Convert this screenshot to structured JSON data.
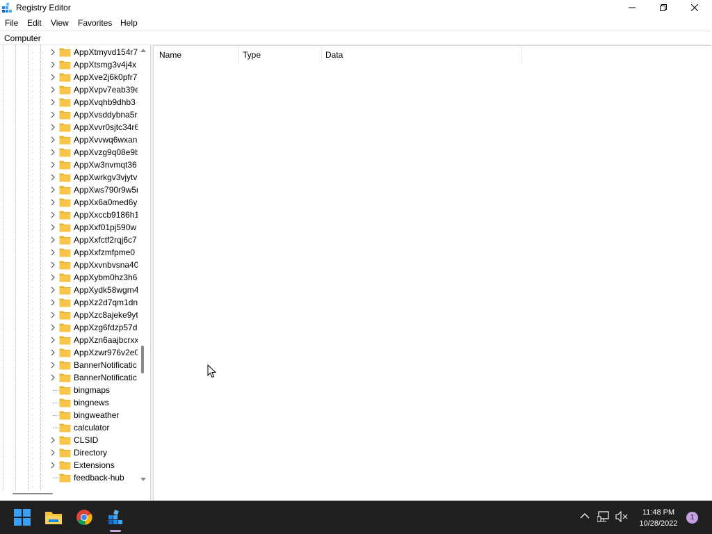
{
  "window": {
    "title": "Registry Editor"
  },
  "menu": [
    "File",
    "Edit",
    "View",
    "Favorites",
    "Help"
  ],
  "address": "Computer",
  "tree": [
    {
      "label": "AppXtmyvd154r7",
      "expandable": true
    },
    {
      "label": "AppXtsmg3v4j4x",
      "expandable": true
    },
    {
      "label": "AppXve2j6k0pfr7",
      "expandable": true
    },
    {
      "label": "AppXvpv7eab39e",
      "expandable": true
    },
    {
      "label": "AppXvqhb9dhb3",
      "expandable": true
    },
    {
      "label": "AppXvsddybna5r",
      "expandable": true
    },
    {
      "label": "AppXvvr0sjtc34r6",
      "expandable": true
    },
    {
      "label": "AppXvvwq6wxan",
      "expandable": true
    },
    {
      "label": "AppXvzg9q08e9b",
      "expandable": true
    },
    {
      "label": "AppXw3nvmqt36",
      "expandable": true
    },
    {
      "label": "AppXwrkgv3vjytv",
      "expandable": true
    },
    {
      "label": "AppXws790r9w5r",
      "expandable": true
    },
    {
      "label": "AppXx6a0med6y",
      "expandable": true
    },
    {
      "label": "AppXxccb9186h1",
      "expandable": true
    },
    {
      "label": "AppXxf01pj590w",
      "expandable": true
    },
    {
      "label": "AppXxfctf2rqj6c7",
      "expandable": true
    },
    {
      "label": "AppXxfzmfpme0",
      "expandable": true
    },
    {
      "label": "AppXxvnbvsna40",
      "expandable": true
    },
    {
      "label": "AppXybm0hz3h6",
      "expandable": true
    },
    {
      "label": "AppXydk58wgm4",
      "expandable": true
    },
    {
      "label": "AppXz2d7qm1dn",
      "expandable": true
    },
    {
      "label": "AppXzc8ajeke9yt",
      "expandable": true
    },
    {
      "label": "AppXzg6fdzp57d",
      "expandable": true
    },
    {
      "label": "AppXzn6aajbcrxx",
      "expandable": true
    },
    {
      "label": "AppXzwr976v2e0",
      "expandable": true
    },
    {
      "label": "BannerNotificatic",
      "expandable": true
    },
    {
      "label": "BannerNotificatic",
      "expandable": true
    },
    {
      "label": "bingmaps",
      "expandable": false
    },
    {
      "label": "bingnews",
      "expandable": false
    },
    {
      "label": "bingweather",
      "expandable": false
    },
    {
      "label": "calculator",
      "expandable": false
    },
    {
      "label": "CLSID",
      "expandable": true
    },
    {
      "label": "Directory",
      "expandable": true
    },
    {
      "label": "Extensions",
      "expandable": true
    },
    {
      "label": "feedback-hub",
      "expandable": false
    }
  ],
  "list_columns": [
    "Name",
    "Type",
    "Data"
  ],
  "taskbar": {
    "time": "11:48 PM",
    "date": "10/28/2022",
    "notification_count": "1"
  },
  "colors": {
    "taskbar_bg": "#202020",
    "folder": "#f8c548",
    "accent": "#0078d4"
  }
}
